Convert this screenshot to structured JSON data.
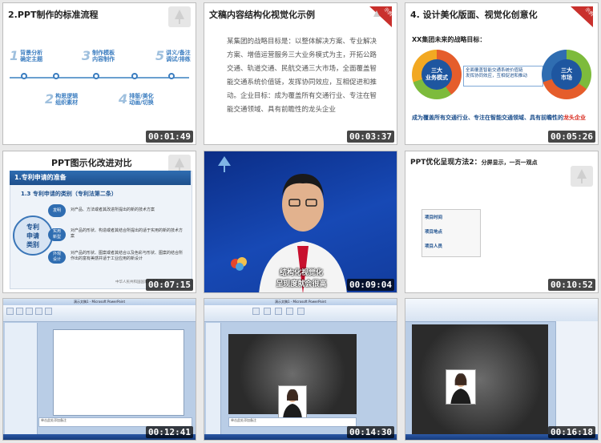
{
  "thumbs": [
    {
      "id": "t1",
      "time": "00:01:49",
      "title": "2.PPT制作的标准流程",
      "steps": [
        {
          "n": "1",
          "text": "背景分析\n确定主题"
        },
        {
          "n": "2",
          "text": "构思逻辑\n组织素材"
        },
        {
          "n": "3",
          "text": "制作模板\n内容制作"
        },
        {
          "n": "4",
          "text": "排版/美化\n动画/切换"
        },
        {
          "n": "5",
          "text": "讲义/备注\n调试/排练"
        }
      ]
    },
    {
      "id": "t2",
      "time": "00:03:37",
      "title": "文稿内容结构化视觉化示例",
      "badge": "示例",
      "para": "某集团的战略目标是：以整体解决方案、专业解决方案、增值运营服务三大业务模式为主，开拓公路交通、轨道交通、民航交通三大市场，全面覆盖智能交通系统价值链，发挥协同效应，互相促进和推动。企业目标：成为覆盖所有交通行业、专注在智能交通领域、具有前瞻性的龙头企业"
    },
    {
      "id": "t3",
      "time": "00:05:26",
      "title": "4. 设计美化版面、视觉化创意化",
      "badge": "示例",
      "subtitle": "XX集团未来的战略目标：",
      "left_ring": "三大\n业务模式",
      "right_ring": "三大\n市场",
      "midtext": "全面覆盖智能交通系统价值链\n发挥协同效应，互相促进和推动",
      "footer": "成为覆盖所有交通行业、专注在智能交通领域、具有前瞻性的",
      "footer_red": "龙头企业"
    },
    {
      "id": "t4",
      "time": "00:07:15",
      "title": "PPT图示化改进对比",
      "bar": "1.专利申请的准备",
      "sub": "1.3  专利申请的类别（专利法第二条）",
      "circle": "专利\n申请\n类别",
      "items": [
        {
          "pill": "发明",
          "desc": "对产品、方法或者其改进所提出的新的技术方案"
        },
        {
          "pill": "实用\n新型",
          "desc": "对产品的形状、构造或者其结合所提出的适于实用的新的技术方案"
        },
        {
          "pill": "外观\n设计",
          "desc": "对产品的形状、图案或者其结合以及色彩与形状、图案的结合所作出的富有美感并适于工业应用的新设计"
        }
      ],
      "footnote": "中华人民共和国国家知识产权局"
    },
    {
      "id": "t5",
      "time": "00:09:04",
      "sub1": "结构化视觉化",
      "sub2": "呈现度就会很高"
    },
    {
      "id": "t6",
      "time": "00:10:52",
      "title": "PPT优化呈现方法2：",
      "title_small": "分屏显示，一页一观点",
      "items": [
        "项目时间",
        "项目地点",
        "项目人员"
      ]
    },
    {
      "id": "t7",
      "time": "00:12:41",
      "wintitle": "演示文稿1 - Microsoft PowerPoint",
      "notes": "单击此处添加备注"
    },
    {
      "id": "t8",
      "time": "00:14:30",
      "wintitle": "演示文稿1 - Microsoft PowerPoint",
      "notes": "单击此处添加备注"
    },
    {
      "id": "t9",
      "time": "00:16:18"
    }
  ],
  "colors": {
    "accent": "#1b4e8c",
    "red": "#d8271b",
    "timestamp_bg": "#000000"
  }
}
